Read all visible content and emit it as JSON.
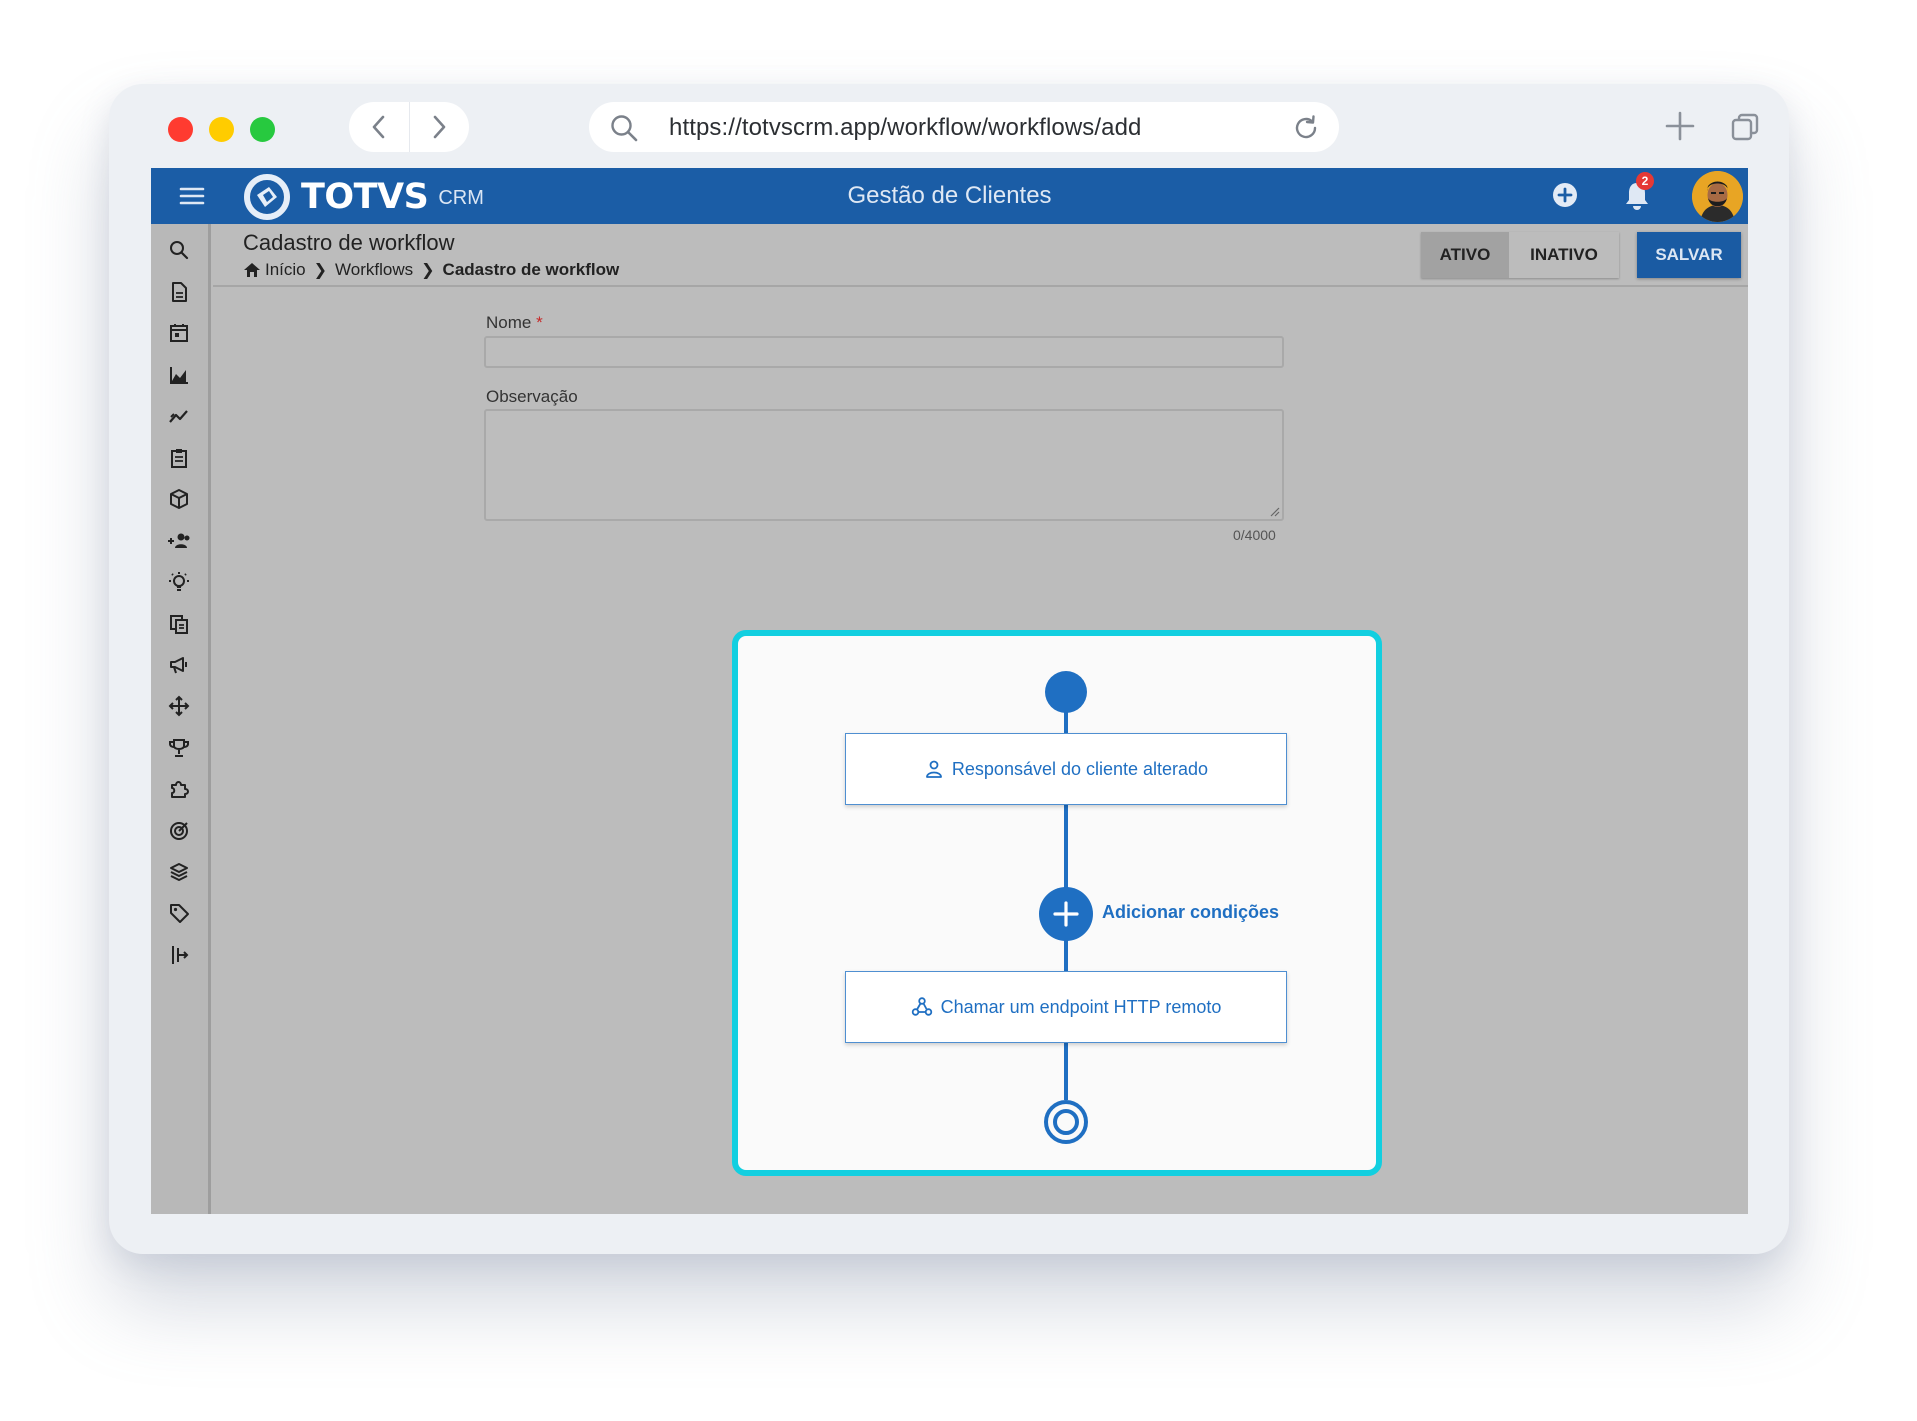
{
  "browser": {
    "url": "https://totvscrm.app/workflow/workflows/add"
  },
  "header": {
    "brand": "TOTVS",
    "brand_sub": "CRM",
    "app_title": "Gestão de Clientes",
    "notification_count": "2"
  },
  "page": {
    "title": "Cadastro de workflow",
    "breadcrumb": [
      {
        "label": "Início"
      },
      {
        "label": "Workflows"
      },
      {
        "label": "Cadastro de workflow"
      }
    ],
    "status_toggle": {
      "active_label": "ATIVO",
      "inactive_label": "INATIVO",
      "selected": "ATIVO"
    },
    "save_label": "SALVAR"
  },
  "form": {
    "name_label": "Nome",
    "name_required_mark": "*",
    "name_value": "",
    "notes_label": "Observação",
    "notes_value": "",
    "notes_counter": "0/4000"
  },
  "workflow": {
    "trigger_label": "Responsável do cliente alterado",
    "add_conditions_label": "Adicionar condições",
    "action_label": "Chamar um endpoint HTTP remoto"
  },
  "sidebar": {
    "items": [
      {
        "icon": "search-icon"
      },
      {
        "icon": "document-icon"
      },
      {
        "icon": "calendar-icon"
      },
      {
        "icon": "area-chart-icon"
      },
      {
        "icon": "trend-chart-icon"
      },
      {
        "icon": "clipboard-icon"
      },
      {
        "icon": "box-icon"
      },
      {
        "icon": "add-group-icon"
      },
      {
        "icon": "lightbulb-icon"
      },
      {
        "icon": "copy-document-icon"
      },
      {
        "icon": "megaphone-icon"
      },
      {
        "icon": "move-arrows-icon"
      },
      {
        "icon": "trophy-icon"
      },
      {
        "icon": "puzzle-icon"
      },
      {
        "icon": "target-icon"
      },
      {
        "icon": "layers-icon"
      },
      {
        "icon": "tag-icon"
      },
      {
        "icon": "align-tool-icon"
      }
    ]
  },
  "colors": {
    "primary": "#1b5da6",
    "accent_highlight": "#12cfe0",
    "workflow_blue": "#1f6fc2",
    "overlay_gray": "#bcbcbc"
  }
}
